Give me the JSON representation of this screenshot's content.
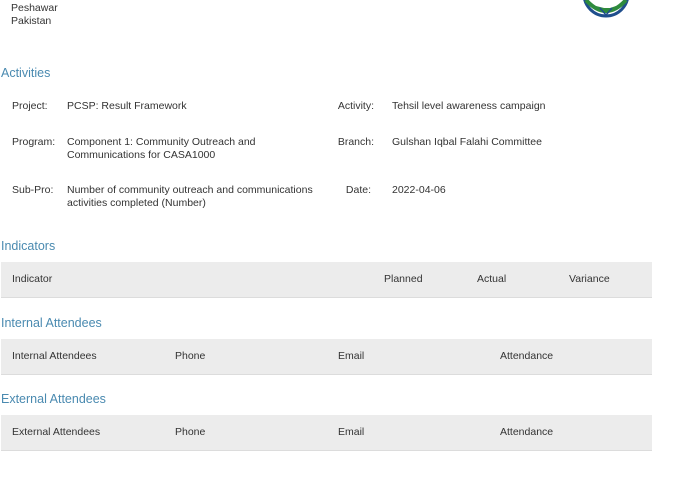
{
  "address": {
    "line1": "Peshawar",
    "line2": "Pakistan"
  },
  "sections": {
    "activities": "Activities",
    "indicators": "Indicators",
    "internal_attendees": "Internal Attendees",
    "external_attendees": "External Attendees"
  },
  "activities": {
    "project_label": "Project:",
    "project_value": "PCSP: Result Framework",
    "program_label": "Program:",
    "program_value_line1": "Component 1: Community Outreach and",
    "program_value_line2": "Communications for CASA1000",
    "subpro_label": "Sub-Pro:",
    "subpro_value_line1": "Number of community outreach and communications",
    "subpro_value_line2": "activities completed (Number)",
    "activity_label": "Activity:",
    "activity_value": "Tehsil level awareness campaign",
    "branch_label": "Branch:",
    "branch_value": "Gulshan Iqbal Falahi Committee",
    "date_label": "Date:",
    "date_value": "2022-04-06"
  },
  "indicators_table": {
    "col_indicator": "Indicator",
    "col_planned": "Planned",
    "col_actual": "Actual",
    "col_variance": "Variance"
  },
  "internal_table": {
    "col_name": "Internal Attendees",
    "col_phone": "Phone",
    "col_email": "Email",
    "col_attendance": "Attendance"
  },
  "external_table": {
    "col_name": "External Attendees",
    "col_phone": "Phone",
    "col_email": "Email",
    "col_attendance": "Attendance"
  },
  "colors": {
    "section_title": "#4a8ab0",
    "table_header_bg": "#ececec",
    "logo_green": "#2e8b3d",
    "logo_blue": "#1f4e8c"
  },
  "icons": {
    "logo": "handshake-logo-icon"
  }
}
